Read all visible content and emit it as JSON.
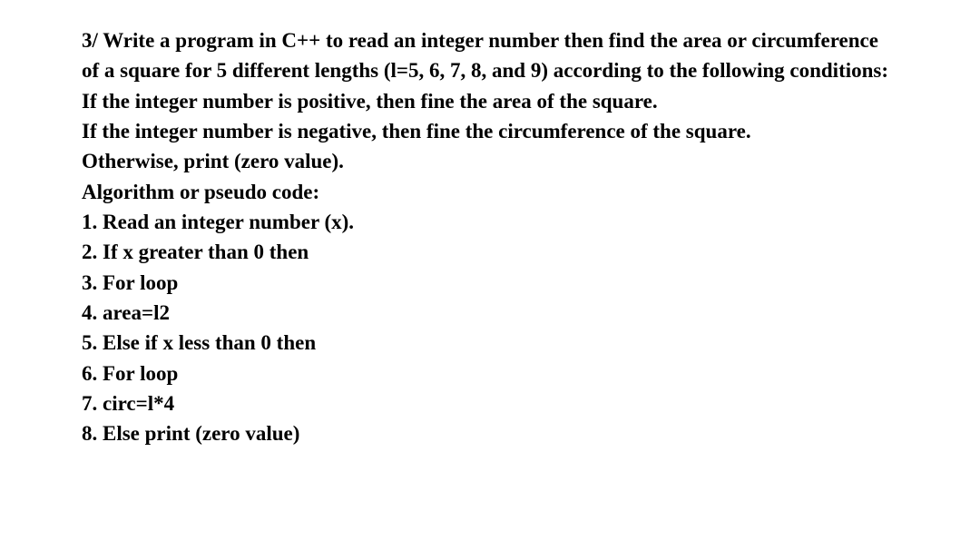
{
  "lines": [
    "3/ Write a program in C++ to read an integer number then find the area or circumference of a square for 5 different lengths (l=5, 6, 7, 8, and 9) according to the following conditions:",
    " If the integer number is positive, then fine the area of the square.",
    "If the integer number is negative, then fine the circumference of the square.",
    "Otherwise, print (zero value).",
    "Algorithm or pseudo code:",
    "1. Read an integer number (x).",
    "2. If x greater than 0 then",
    "3. For loop",
    "4. area=l2",
    "5. Else if x less than 0 then",
    "6. For loop",
    "7. circ=l*4",
    "8. Else print (zero value)"
  ]
}
